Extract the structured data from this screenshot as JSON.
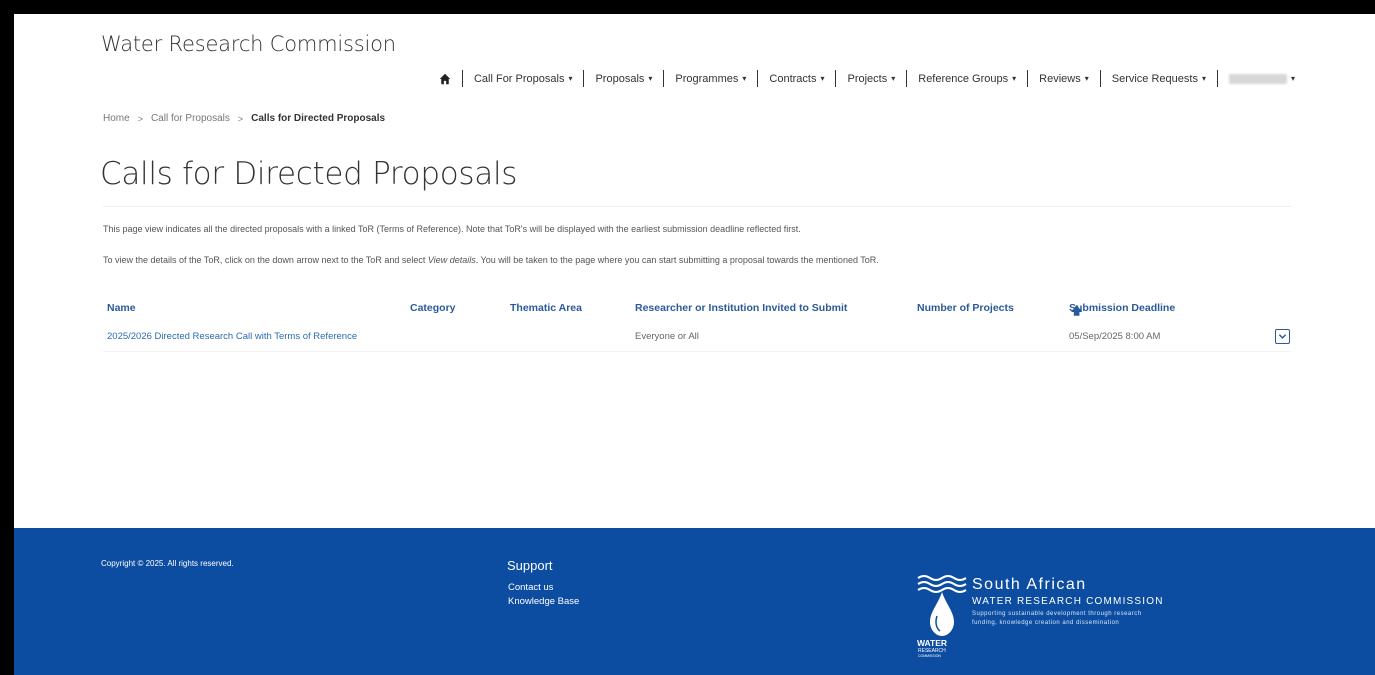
{
  "site": {
    "title": "Water Research Commission"
  },
  "nav": {
    "items": [
      "Call For Proposals",
      "Proposals",
      "Programmes",
      "Contracts",
      "Projects",
      "Reference Groups",
      "Reviews",
      "Service Requests"
    ],
    "home_icon": "home-icon",
    "user_menu": "user-menu (blurred name)"
  },
  "breadcrumb": {
    "home": "Home",
    "parent": "Call for Proposals",
    "current": "Calls for Directed Proposals",
    "separator": ">"
  },
  "page": {
    "title": "Calls for Directed Proposals",
    "intro_1": "This page view indicates all the directed proposals with a linked ToR (Terms of Reference). Note that ToR's will be displayed with the earliest submission deadline reflected first.",
    "intro_2_before": "To view the details of the ToR, click on the down arrow next to the ToR and select ",
    "intro_2_em": "View details",
    "intro_2_after": ". You will be taken to the page where you can start submitting a proposal towards the mentioned ToR."
  },
  "table": {
    "columns": {
      "name": "Name",
      "category": "Category",
      "thematic": "Thematic Area",
      "invited": "Researcher or Institution Invited to Submit",
      "projects": "Number of Projects",
      "deadline": "Submission Deadline"
    },
    "sort_icon": "arrow-up-icon",
    "rows": [
      {
        "name": "2025/2026 Directed Research Call with Terms of Reference",
        "category": "",
        "thematic": "",
        "invited": "Everyone or All",
        "projects": "",
        "deadline": "05/Sep/2025 8:00 AM"
      }
    ]
  },
  "footer": {
    "copyright": "Copyright © 2025. All rights reserved.",
    "support_title": "Support",
    "links": [
      "Contact us",
      "Knowledge Base"
    ],
    "logo": {
      "line1": "South African",
      "line2": "WATER RESEARCH COMMISSION",
      "tagline1": "Supporting sustainable development through research",
      "tagline2": "funding, knowledge creation and dissemination",
      "mark_word1": "WATER",
      "mark_word2": "RESEARCH",
      "mark_word3": "COMMISSION"
    }
  },
  "colors": {
    "link": "#2b6cb0",
    "header_link": "#2b5a9a",
    "footer_bg": "#0c4da2"
  }
}
